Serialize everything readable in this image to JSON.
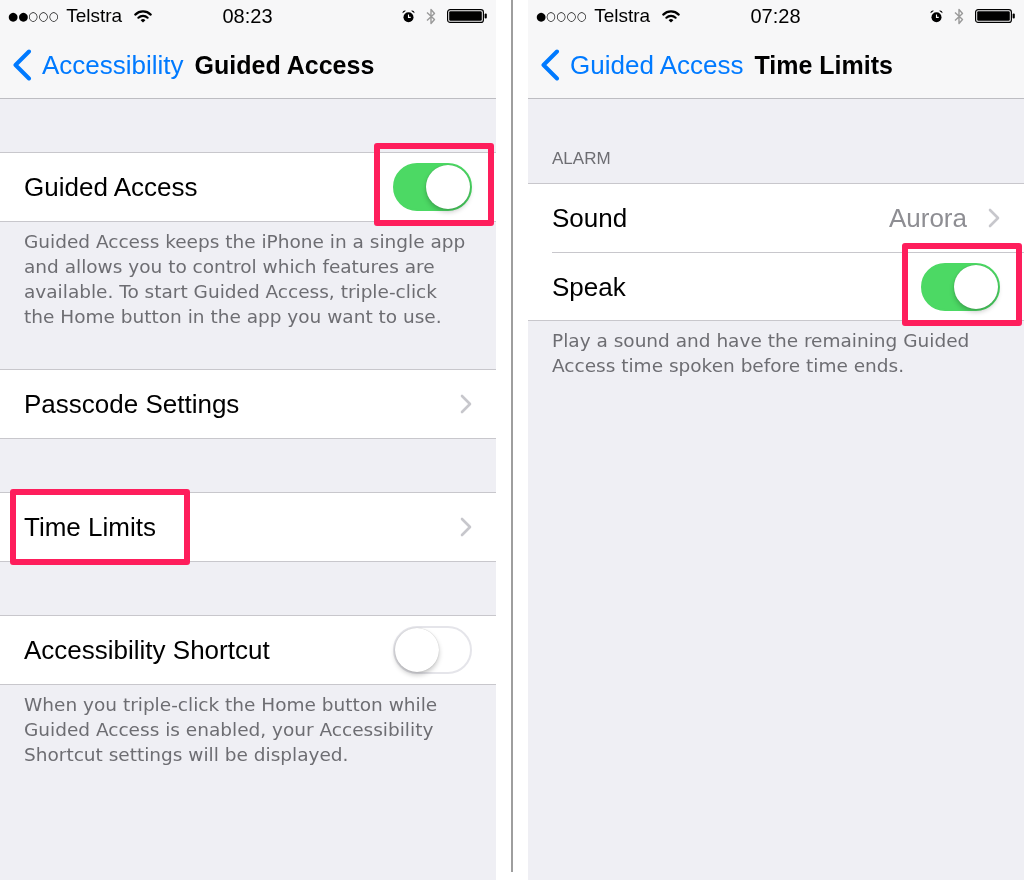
{
  "screens": [
    {
      "status_bar": {
        "signal": "●●○○○",
        "carrier": "Telstra",
        "time": "08:23"
      },
      "nav_bar": {
        "back_label": "Accessibility",
        "title": "Guided Access"
      },
      "groups": [
        {
          "rows": [
            {
              "kind": "toggle",
              "label": "Guided Access",
              "on": true,
              "highlighted": true
            }
          ],
          "footer": "Guided Access keeps the iPhone in a single app and allows you to control which features are available. To start Guided Access, triple-click the Home button in the app you want to use."
        },
        {
          "rows": [
            {
              "kind": "link",
              "label": "Passcode Settings",
              "highlighted": false
            }
          ]
        },
        {
          "rows": [
            {
              "kind": "link",
              "label": "Time Limits",
              "highlighted": true
            }
          ]
        },
        {
          "rows": [
            {
              "kind": "toggle",
              "label": "Accessibility Shortcut",
              "on": false,
              "highlighted": false
            }
          ],
          "footer": "When you triple-click the Home button while Guided Access is enabled, your Accessibility Shortcut settings will be displayed."
        }
      ]
    },
    {
      "status_bar": {
        "signal": "●○○○○",
        "carrier": "Telstra",
        "time": "07:28"
      },
      "nav_bar": {
        "back_label": "Guided Access",
        "title": "Time Limits"
      },
      "groups": [
        {
          "header": "ALARM",
          "rows": [
            {
              "kind": "link",
              "label": "Sound",
              "value": "Aurora",
              "highlighted": false
            },
            {
              "kind": "toggle",
              "label": "Speak",
              "on": true,
              "highlighted": true
            }
          ],
          "footer": "Play a sound and have the remaining Guided Access time spoken before time ends."
        }
      ]
    }
  ]
}
